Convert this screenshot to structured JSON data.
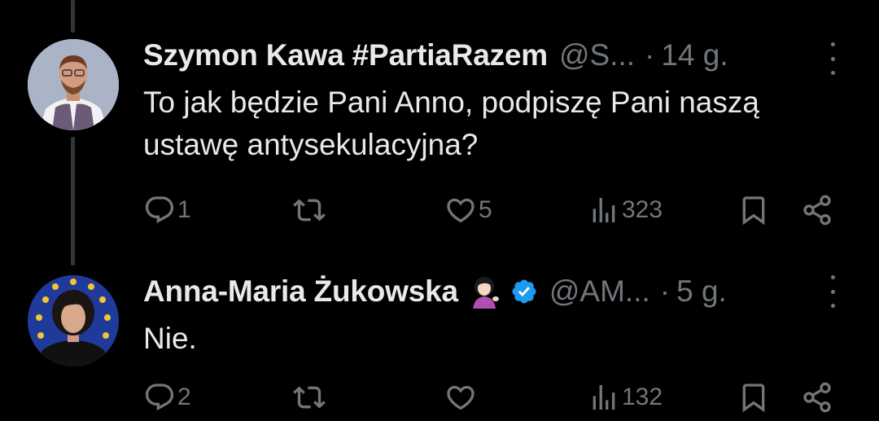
{
  "tweets": [
    {
      "name": "Szymon Kawa #PartiaRazem",
      "handle": "@S...",
      "separator": "·",
      "time": "14 g.",
      "text_lines": [
        "To jak będzie Pani Anno, podpiszę Pani naszą",
        "ustawę antysekulacyjna?"
      ],
      "reply_count": "1",
      "retweet_count": "",
      "like_count": "5",
      "view_count": "323",
      "verified": false
    },
    {
      "name": "Anna-Maria Żukowska",
      "handle": "@AM...",
      "separator": "·",
      "time": "5 g.",
      "text_lines": [
        "Nie."
      ],
      "reply_count": "2",
      "retweet_count": "",
      "like_count": "",
      "view_count": "132",
      "verified": true,
      "emoji": "woman-tipping-hand-emoji"
    }
  ],
  "colors": {
    "background": "#000000",
    "text_primary": "#e7e9ea",
    "text_secondary": "#71767b",
    "verified_blue": "#1d9bf0",
    "thread_line": "#333639"
  }
}
